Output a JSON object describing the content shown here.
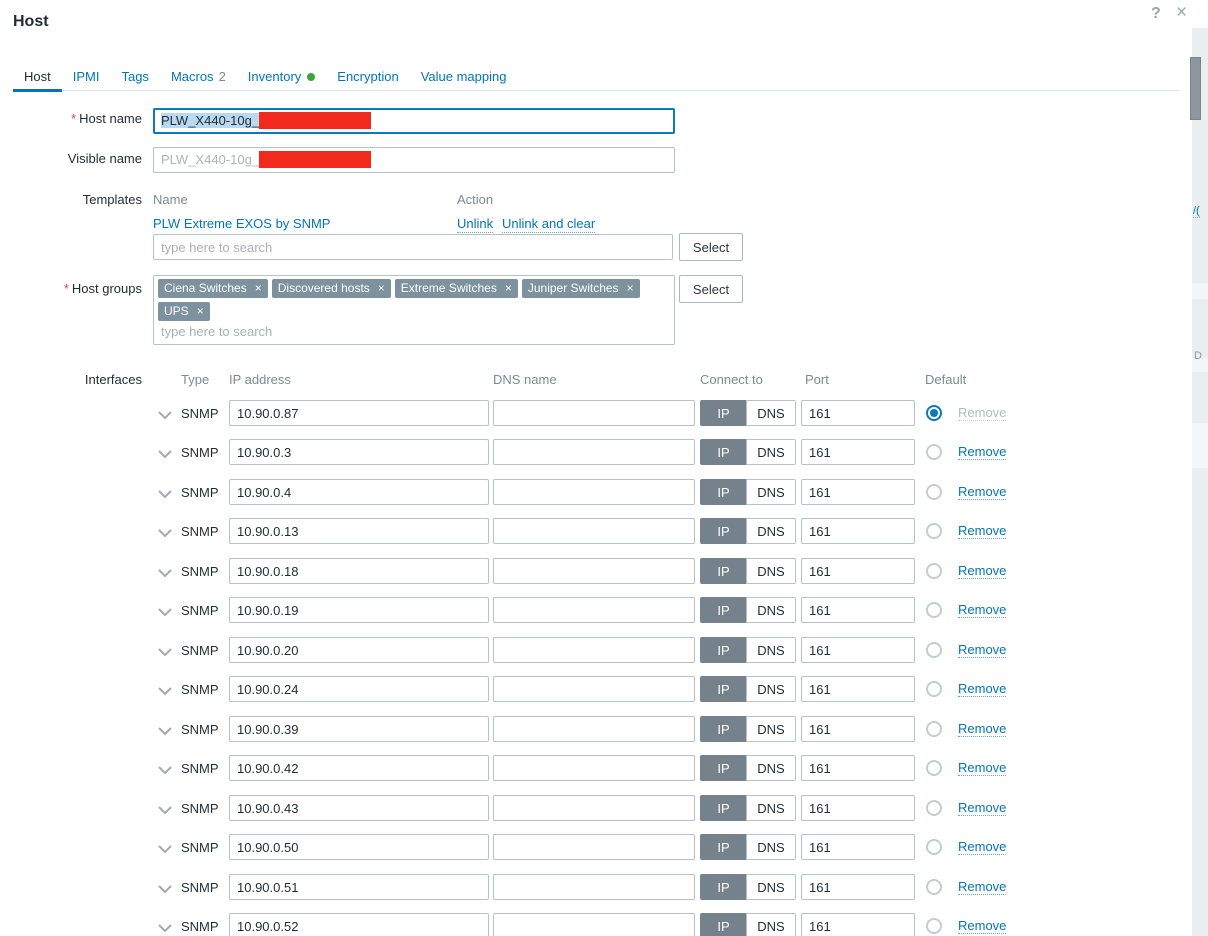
{
  "dialog": {
    "title": "Host",
    "help_icon": "?",
    "close_icon": "×"
  },
  "tabs": {
    "items": [
      {
        "label": "Host",
        "active": true
      },
      {
        "label": "IPMI"
      },
      {
        "label": "Tags"
      },
      {
        "label": "Macros",
        "badge": "2"
      },
      {
        "label": "Inventory",
        "status_dot": "green"
      },
      {
        "label": "Encryption"
      },
      {
        "label": "Value mapping"
      }
    ]
  },
  "form": {
    "host_name": {
      "label": "Host name",
      "required": true,
      "value": "PLW_X440-10g_",
      "redacted": true
    },
    "visible_name": {
      "label": "Visible name",
      "value": "PLW_X440-10g_",
      "redacted": true
    },
    "templates": {
      "label": "Templates",
      "name_header": "Name",
      "action_header": "Action",
      "linked_template": "PLW Extreme EXOS by SNMP",
      "unlink_label": "Unlink",
      "unlink_clear_label": "Unlink and clear",
      "search_placeholder": "type here to search",
      "select_label": "Select"
    },
    "host_groups": {
      "label": "Host groups",
      "required": true,
      "chips": [
        "Ciena Switches",
        "Discovered hosts",
        "Extreme Switches",
        "Juniper Switches",
        "UPS"
      ],
      "chip_remove_icon": "×",
      "search_placeholder": "type here to search",
      "select_label": "Select"
    },
    "interfaces": {
      "label": "Interfaces",
      "headers": {
        "type": "Type",
        "ip": "IP address",
        "dns": "DNS name",
        "connect": "Connect to",
        "port": "Port",
        "default": "Default"
      },
      "connect_ip_label": "IP",
      "connect_dns_label": "DNS",
      "remove_label": "Remove",
      "rows": [
        {
          "type": "SNMP",
          "ip": "10.90.0.87",
          "dns": "",
          "port": "161",
          "default_selected": true,
          "remove_enabled": false
        },
        {
          "type": "SNMP",
          "ip": "10.90.0.3",
          "dns": "",
          "port": "161",
          "default_selected": false,
          "remove_enabled": true
        },
        {
          "type": "SNMP",
          "ip": "10.90.0.4",
          "dns": "",
          "port": "161",
          "default_selected": false,
          "remove_enabled": true
        },
        {
          "type": "SNMP",
          "ip": "10.90.0.13",
          "dns": "",
          "port": "161",
          "default_selected": false,
          "remove_enabled": true
        },
        {
          "type": "SNMP",
          "ip": "10.90.0.18",
          "dns": "",
          "port": "161",
          "default_selected": false,
          "remove_enabled": true
        },
        {
          "type": "SNMP",
          "ip": "10.90.0.19",
          "dns": "",
          "port": "161",
          "default_selected": false,
          "remove_enabled": true
        },
        {
          "type": "SNMP",
          "ip": "10.90.0.20",
          "dns": "",
          "port": "161",
          "default_selected": false,
          "remove_enabled": true
        },
        {
          "type": "SNMP",
          "ip": "10.90.0.24",
          "dns": "",
          "port": "161",
          "default_selected": false,
          "remove_enabled": true
        },
        {
          "type": "SNMP",
          "ip": "10.90.0.39",
          "dns": "",
          "port": "161",
          "default_selected": false,
          "remove_enabled": true
        },
        {
          "type": "SNMP",
          "ip": "10.90.0.42",
          "dns": "",
          "port": "161",
          "default_selected": false,
          "remove_enabled": true
        },
        {
          "type": "SNMP",
          "ip": "10.90.0.43",
          "dns": "",
          "port": "161",
          "default_selected": false,
          "remove_enabled": true
        },
        {
          "type": "SNMP",
          "ip": "10.90.0.50",
          "dns": "",
          "port": "161",
          "default_selected": false,
          "remove_enabled": true
        },
        {
          "type": "SNMP",
          "ip": "10.90.0.51",
          "dns": "",
          "port": "161",
          "default_selected": false,
          "remove_enabled": true
        },
        {
          "type": "SNMP",
          "ip": "10.90.0.52",
          "dns": "",
          "port": "161",
          "default_selected": false,
          "remove_enabled": true
        }
      ]
    }
  },
  "background": {
    "link_fragment": "/(",
    "text_fragment": "D"
  }
}
